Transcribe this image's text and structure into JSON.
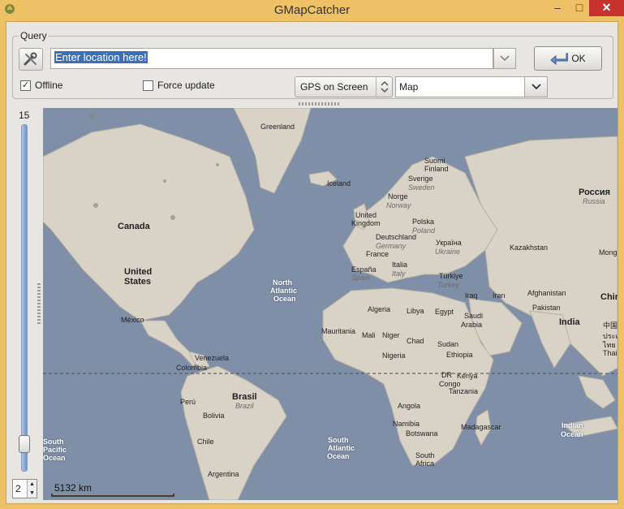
{
  "window": {
    "title": "GMapCatcher",
    "minimize": "–",
    "maximize": "□",
    "close": "✕"
  },
  "query": {
    "group_label": "Query",
    "tools_icon": "wrench-screwdriver-icon",
    "location_value": "Enter location here!",
    "ok_label": "OK",
    "offline_label": "Offline",
    "offline_checked": true,
    "force_update_label": "Force update",
    "force_update_checked": false,
    "gps_mode": "GPS on Screen",
    "map_type": "Map"
  },
  "zoom": {
    "level_label": "15",
    "spin_value": "2"
  },
  "map": {
    "scale_label": "5132 km",
    "labels": [
      {
        "text": "Greenland",
        "cls": "ml"
      },
      {
        "text": "Iceland",
        "cls": "ml"
      },
      {
        "text": "Suomi",
        "cls": "ml"
      },
      {
        "text": "Finland",
        "cls": "ml"
      },
      {
        "text": "Sverige",
        "cls": "ml"
      },
      {
        "text": "Sweden",
        "cls": "ml i"
      },
      {
        "text": "Norge",
        "cls": "ml"
      },
      {
        "text": "Norway",
        "cls": "ml i"
      },
      {
        "text": "United",
        "cls": "ml"
      },
      {
        "text": "Kingdom",
        "cls": "ml"
      },
      {
        "text": "Polska",
        "cls": "ml"
      },
      {
        "text": "Poland",
        "cls": "ml i"
      },
      {
        "text": "Deutschland",
        "cls": "ml"
      },
      {
        "text": "Germany",
        "cls": "ml i"
      },
      {
        "text": "Україна",
        "cls": "ml"
      },
      {
        "text": "Ukraine",
        "cls": "ml i"
      },
      {
        "text": "France",
        "cls": "ml"
      },
      {
        "text": "España",
        "cls": "ml"
      },
      {
        "text": "Spain",
        "cls": "ml i"
      },
      {
        "text": "Italia",
        "cls": "ml"
      },
      {
        "text": "Italy",
        "cls": "ml i"
      },
      {
        "text": "Türkiye",
        "cls": "ml"
      },
      {
        "text": "Turkey",
        "cls": "ml i"
      },
      {
        "text": "Россия",
        "cls": "ml big"
      },
      {
        "text": "Russia",
        "cls": "ml i"
      },
      {
        "text": "Kazakhstan",
        "cls": "ml"
      },
      {
        "text": "Mongolia",
        "cls": "ml"
      },
      {
        "text": "Canada",
        "cls": "ml big"
      },
      {
        "text": "United",
        "cls": "ml big"
      },
      {
        "text": "States",
        "cls": "ml big"
      },
      {
        "text": "México",
        "cls": "ml"
      },
      {
        "text": "North",
        "cls": "ml sea"
      },
      {
        "text": "Atlantic",
        "cls": "ml sea"
      },
      {
        "text": "Ocean",
        "cls": "ml sea"
      },
      {
        "text": "Iraq",
        "cls": "ml"
      },
      {
        "text": "Iran",
        "cls": "ml"
      },
      {
        "text": "Afghanistan",
        "cls": "ml"
      },
      {
        "text": "Pakistan",
        "cls": "ml"
      },
      {
        "text": "China",
        "cls": "ml big"
      },
      {
        "text": "India",
        "cls": "ml big"
      },
      {
        "text": "中国",
        "cls": "ml"
      },
      {
        "text": "ประเทศ",
        "cls": "ml"
      },
      {
        "text": "ไทย",
        "cls": "ml"
      },
      {
        "text": "Thailand",
        "cls": "ml"
      },
      {
        "text": "Algeria",
        "cls": "ml"
      },
      {
        "text": "Libya",
        "cls": "ml"
      },
      {
        "text": "Egypt",
        "cls": "ml"
      },
      {
        "text": "Saudi",
        "cls": "ml"
      },
      {
        "text": "Arabia",
        "cls": "ml"
      },
      {
        "text": "Mauritania",
        "cls": "ml"
      },
      {
        "text": "Mali",
        "cls": "ml"
      },
      {
        "text": "Niger",
        "cls": "ml"
      },
      {
        "text": "Chad",
        "cls": "ml"
      },
      {
        "text": "Sudan",
        "cls": "ml"
      },
      {
        "text": "Nigeria",
        "cls": "ml"
      },
      {
        "text": "Ethiopia",
        "cls": "ml"
      },
      {
        "text": "DR",
        "cls": "ml"
      },
      {
        "text": "Congo",
        "cls": "ml"
      },
      {
        "text": "Kenya",
        "cls": "ml"
      },
      {
        "text": "Tanzania",
        "cls": "ml"
      },
      {
        "text": "Angola",
        "cls": "ml"
      },
      {
        "text": "Namibia",
        "cls": "ml"
      },
      {
        "text": "Botswana",
        "cls": "ml"
      },
      {
        "text": "South",
        "cls": "ml"
      },
      {
        "text": "Africa",
        "cls": "ml"
      },
      {
        "text": "Madagascar",
        "cls": "ml"
      },
      {
        "text": "Indian",
        "cls": "ml sea"
      },
      {
        "text": "Ocean",
        "cls": "ml sea"
      },
      {
        "text": "Venezuela",
        "cls": "ml"
      },
      {
        "text": "Colombia",
        "cls": "ml"
      },
      {
        "text": "Brasil",
        "cls": "ml big"
      },
      {
        "text": "Brazil",
        "cls": "ml i"
      },
      {
        "text": "Perú",
        "cls": "ml"
      },
      {
        "text": "Bolivia",
        "cls": "ml"
      },
      {
        "text": "Chile",
        "cls": "ml"
      },
      {
        "text": "Argentina",
        "cls": "ml"
      },
      {
        "text": "South",
        "cls": "ml sea"
      },
      {
        "text": "Atlantic",
        "cls": "ml sea"
      },
      {
        "text": "Ocean",
        "cls": "ml sea"
      },
      {
        "text": "South",
        "cls": "ml sea"
      },
      {
        "text": "Pacific",
        "cls": "ml sea"
      },
      {
        "text": "Ocean",
        "cls": "ml sea"
      }
    ]
  }
}
